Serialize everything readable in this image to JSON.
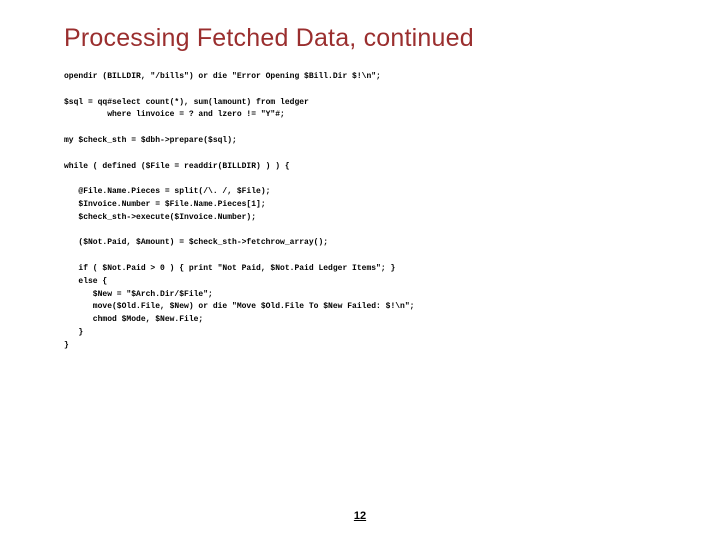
{
  "title": "Processing Fetched Data, continued",
  "code_lines": [
    "opendir (BILLDIR, \"/bills\") or die \"Error Opening $Bill.Dir $!\\n\";",
    "",
    "$sql = qq#select count(*), sum(lamount) from ledger",
    "         where linvoice = ? and lzero != \"Y\"#;",
    "",
    "my $check_sth = $dbh->prepare($sql);",
    "",
    "while ( defined ($File = readdir(BILLDIR) ) ) {",
    "",
    "   @File.Name.Pieces = split(/\\. /, $File);",
    "   $Invoice.Number = $File.Name.Pieces[1];",
    "   $check_sth->execute($Invoice.Number);",
    "",
    "   ($Not.Paid, $Amount) = $check_sth->fetchrow_array();",
    "",
    "   if ( $Not.Paid > 0 ) { print \"Not Paid, $Not.Paid Ledger Items\"; }",
    "   else {",
    "      $New = \"$Arch.Dir/$File\";",
    "      move($Old.File, $New) or die \"Move $Old.File To $New Failed: $!\\n\";",
    "      chmod $Mode, $New.File;",
    "   }",
    "}"
  ],
  "page_number": "12"
}
